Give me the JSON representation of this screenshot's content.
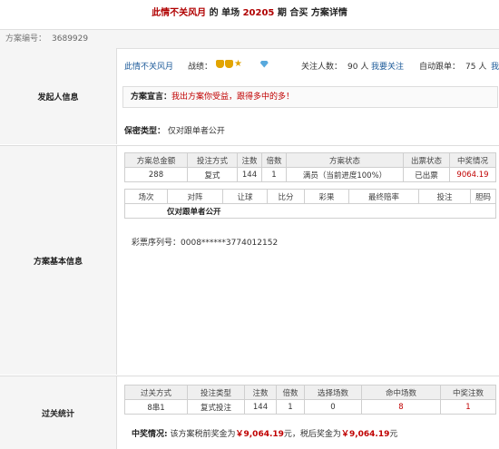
{
  "header": {
    "user": "此情不关风月",
    "text1": "的 单场",
    "issue": "20205",
    "text2": "期 合买 方案详情"
  },
  "plan_no": {
    "label": "方案编号：",
    "value": "3689929"
  },
  "initiator": {
    "section_label": "发起人信息",
    "name": "此情不关风月",
    "record_label": "战绩：",
    "follow_count_label": "关注人数：",
    "follow_count": "90 人",
    "follow_link": "我要关注",
    "auto_label": "自动跟单：",
    "auto_count": "75 人",
    "auto_link": "我",
    "decl_label": "方案宣言：",
    "decl_text": "我出方案你受益，跟得多中的多！",
    "secret_label": "保密类型：",
    "secret_value": "仅对跟单者公开"
  },
  "plan_info": {
    "section_label": "方案基本信息",
    "headers": [
      "方案总金额",
      "投注方式",
      "注数",
      "倍数",
      "方案状态",
      "出票状态",
      "中奖情况"
    ],
    "row": [
      "288",
      "复式",
      "144",
      "1",
      "满员（当前进度100%）",
      "已出票",
      "9064.19"
    ],
    "match_headers": [
      "场次",
      "对阵",
      "让球",
      "比分",
      "彩果",
      "最终赔率",
      "投注",
      "胆码"
    ],
    "match_note": "仅对跟单者公开",
    "serial_label": "彩票序列号：",
    "serial": "0008******3774012152"
  },
  "pass_stats": {
    "section_label": "过关统计",
    "headers": [
      "过关方式",
      "投注类型",
      "注数",
      "倍数",
      "选择场数",
      "命中场数",
      "中奖注数"
    ],
    "row": [
      "8串1",
      "复式投注",
      "144",
      "1",
      "0",
      "8",
      "1"
    ],
    "win_label": "中奖情况:",
    "win_text1": "该方案税前奖金为",
    "pre_tax": "￥9,064.19",
    "win_text2": "元，税后奖金为",
    "after_tax": "￥9,064.19",
    "win_text3": "元"
  }
}
